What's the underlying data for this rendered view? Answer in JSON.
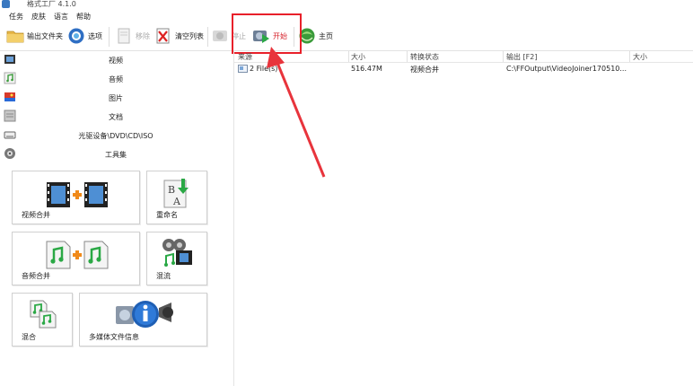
{
  "window": {
    "title": "格式工厂  4.1.0"
  },
  "menu": {
    "items": [
      "任务",
      "皮肤",
      "语言",
      "帮助"
    ]
  },
  "toolbar": {
    "output_folder": "输出文件夹",
    "options": "选项",
    "remove": "移除",
    "clear_list": "清空列表",
    "stop": "停止",
    "start": "开始",
    "home": "主页"
  },
  "sidebar": {
    "categories": [
      "视频",
      "音频",
      "图片",
      "文档",
      "光驱设备\\DVD\\CD\\ISO",
      "工具集"
    ],
    "tools": [
      "视频合并",
      "重命名",
      "音频合并",
      "混流",
      "混合",
      "多媒体文件信息"
    ]
  },
  "list": {
    "columns": [
      "来源",
      "大小",
      "转换状态",
      "输出 [F2]",
      "大小"
    ],
    "rows": [
      {
        "source": "2 File(s)",
        "size": "516.47M",
        "status": "视频合并",
        "output": "C:\\FFOutput\\VideoJoiner170510...",
        "out_size": ""
      }
    ]
  },
  "colors": {
    "highlight": "#e8202a",
    "start_text": "#d6202a",
    "accent": "#3a78c0"
  }
}
